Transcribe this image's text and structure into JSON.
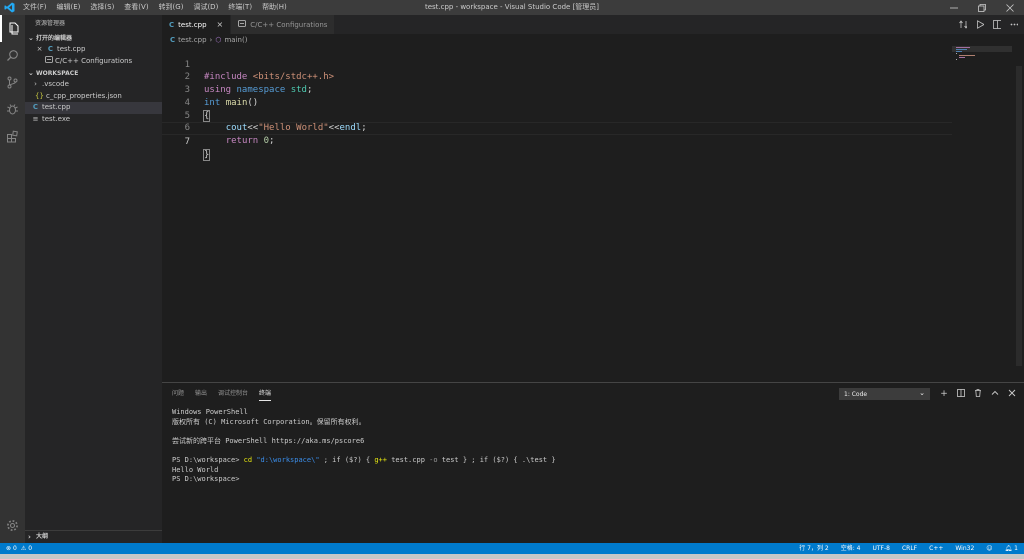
{
  "app": {
    "window_title": "test.cpp - workspace - Visual Studio Code [管理员]",
    "menus": [
      "文件(F)",
      "编辑(E)",
      "选择(S)",
      "查看(V)",
      "转到(G)",
      "调试(D)",
      "终端(T)",
      "帮助(H)"
    ],
    "accent": "#007acc",
    "logo_icon": "vscode-logo-icon"
  },
  "activity": [
    "explorer-icon",
    "search-icon",
    "source-control-icon",
    "debug-icon",
    "extensions-icon",
    "settings-gear-icon"
  ],
  "sidebar": {
    "title": "资源管理器",
    "open_editors_header": "打开的编辑器",
    "open_editors": [
      {
        "label": "test.cpp",
        "close": "×",
        "icon": "cpp-file-icon"
      },
      {
        "label": "C/C++ Configurations",
        "icon": "settings-file-icon"
      }
    ],
    "workspace_header": "WORKSPACE",
    "tree": [
      {
        "label": ".vscode",
        "type": "folder"
      },
      {
        "label": "c_cpp_properties.json",
        "type": "json"
      },
      {
        "label": "test.cpp",
        "type": "cpp"
      },
      {
        "label": "test.exe",
        "type": "exe"
      }
    ],
    "outline_header": "大纲"
  },
  "tabs": [
    {
      "label": "test.cpp",
      "close": "×",
      "icon": "cpp-file-icon",
      "active": true
    },
    {
      "label": "C/C++ Configurations",
      "icon": "settings-file-icon",
      "active": false
    }
  ],
  "breadcrumb": {
    "file": "test.cpp",
    "separator": "›",
    "symbol": "main()"
  },
  "editor": {
    "line_numbers": [
      "1",
      "2",
      "3",
      "4",
      "5",
      "6",
      "7"
    ],
    "current_line": 7
  },
  "panel": {
    "tabs": [
      "问题",
      "输出",
      "调试控制台",
      "终端"
    ],
    "active_tab": "终端",
    "terminal_select": "1: Code",
    "terminal_lines": [
      "Windows PowerShell",
      "版权所有 (C) Microsoft Corporation。保留所有权利。",
      "",
      "尝试新的跨平台 PowerShell https://aka.ms/pscore6",
      ""
    ],
    "cmd": {
      "prompt": "PS D:\\workspace> ",
      "cd": "cd",
      "path": "\"d:\\workspace\\\"",
      "part1": " ; if ($?) { ",
      "gpp": "g++",
      "part2": " test.cpp ",
      "flag": "-o",
      "part3": " test } ; if ($?) { .\\test }"
    },
    "output_lines": [
      "Hello World",
      "PS D:\\workspace>"
    ]
  },
  "status": {
    "errors": "0",
    "warnings": "0",
    "position": "行 7，列 2",
    "spaces": "空格: 4",
    "encoding": "UTF-8",
    "eol": "CRLF",
    "language": "C++",
    "platform": "Win32",
    "bell": "1"
  }
}
